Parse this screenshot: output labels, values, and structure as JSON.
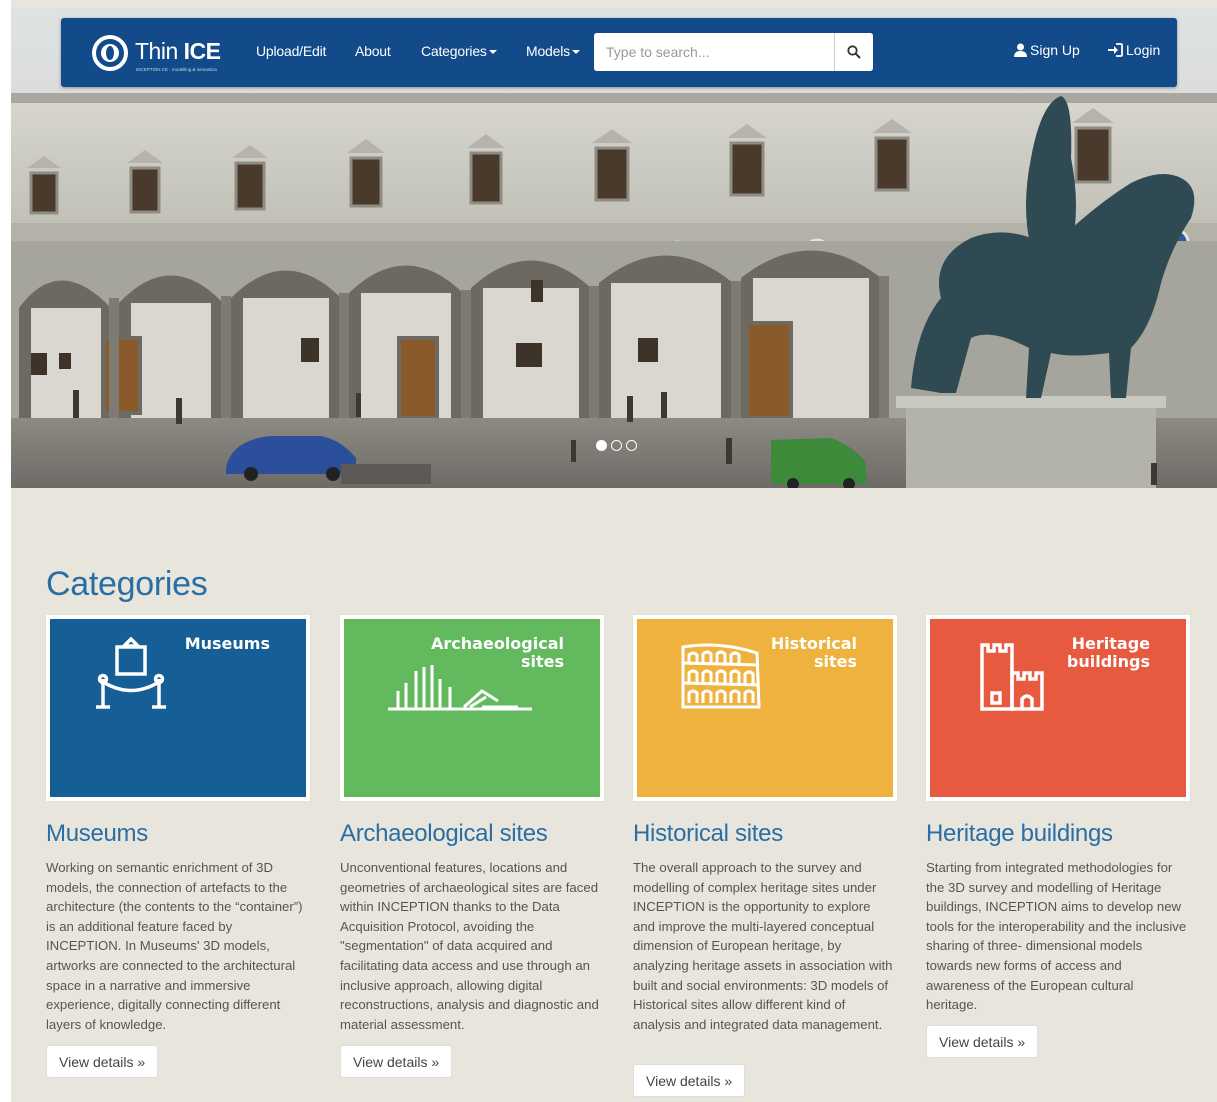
{
  "brand": {
    "name_light": "Thin ",
    "name_bold": "ICE",
    "tagline": "INCEPTION CE · modelling & semantics"
  },
  "nav": {
    "upload": "Upload/Edit",
    "about": "About",
    "categories": "Categories",
    "models": "Models",
    "signup": "Sign Up",
    "login": "Login"
  },
  "search": {
    "placeholder": "Type to search..."
  },
  "carousel": {
    "slides": 3,
    "active_index": 0
  },
  "colors": {
    "navbar": "#124a8a",
    "museums": "#155e96",
    "archaeological": "#63ba5e",
    "historical": "#efb23e",
    "heritage": "#e75a40",
    "title_blue": "#2a6ea5"
  },
  "section_title": "Categories",
  "categories": [
    {
      "tile_label": "Museums",
      "title": "Museums",
      "text": "Working on semantic enrichment of 3D models, the connection of artefacts to the architecture (the contents to the “container”) is an additional feature faced by INCEPTION. In Museums' 3D models, artworks are connected to the architectural space in a narrative and immersive experience, digitally connecting different layers of knowledge.",
      "button": "View details »"
    },
    {
      "tile_label": "Archaeological sites",
      "title": "Archaeological sites",
      "text": "Unconventional features, locations and geometries of archaeological sites are faced within INCEPTION thanks to the Data Acquisition Protocol, avoiding the \"segmentation\" of data acquired and facilitating data access and use through an inclusive approach, allowing digital reconstructions, analysis and diagnostic and material assessment.",
      "button": "View details »"
    },
    {
      "tile_label": "Historical sites",
      "title": "Historical sites",
      "text": "The overall approach to the survey and modelling of complex heritage sites under INCEPTION is the opportunity to explore and improve the multi-layered conceptual dimension of European heritage, by analyzing heritage assets in association with built and social environments: 3D models of Historical sites allow different kind of analysis and integrated data management.",
      "button": "View details »"
    },
    {
      "tile_label": "Heritage buildings",
      "title": "Heritage buildings",
      "text": "Starting from integrated methodologies for the 3D survey and modelling of Heritage buildings, INCEPTION aims to develop new tools for the interoperability and the inclusive sharing of three- dimensional models towards new forms of access and awareness of the European cultural heritage.",
      "button": "View details »"
    }
  ]
}
